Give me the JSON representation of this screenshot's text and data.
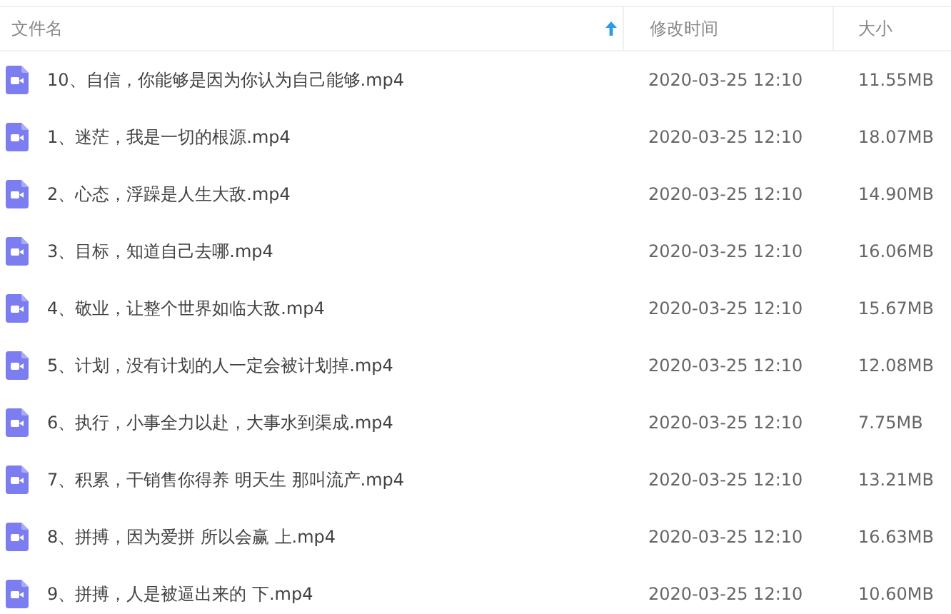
{
  "columns": [
    {
      "label": "文件名",
      "sorted": true
    },
    {
      "label": "修改时间",
      "sorted": false
    },
    {
      "label": "大小",
      "sorted": false
    }
  ],
  "rows": [
    {
      "name": "10、自信，你能够是因为你认为自己能够.mp4",
      "modified": "2020-03-25 12:10",
      "size": "11.55MB"
    },
    {
      "name": "1、迷茫，我是一切的根源.mp4",
      "modified": "2020-03-25 12:10",
      "size": "18.07MB"
    },
    {
      "name": "2、心态，浮躁是人生大敌.mp4",
      "modified": "2020-03-25 12:10",
      "size": "14.90MB"
    },
    {
      "name": "3、目标，知道自己去哪.mp4",
      "modified": "2020-03-25 12:10",
      "size": "16.06MB"
    },
    {
      "name": "4、敬业，让整个世界如临大敌.mp4",
      "modified": "2020-03-25 12:10",
      "size": "15.67MB"
    },
    {
      "name": "5、计划，没有计划的人一定会被计划掉.mp4",
      "modified": "2020-03-25 12:10",
      "size": "12.08MB"
    },
    {
      "name": "6、执行，小事全力以赴，大事水到渠成.mp4",
      "modified": "2020-03-25 12:10",
      "size": "7.75MB"
    },
    {
      "name": "7、积累，干销售你得养 明天生 那叫流产.mp4",
      "modified": "2020-03-25 12:10",
      "size": "13.21MB"
    },
    {
      "name": "8、拼搏，因为爱拼 所以会赢 上.mp4",
      "modified": "2020-03-25 12:10",
      "size": "16.63MB"
    },
    {
      "name": "9、拼搏，人是被逼出来的 下.mp4",
      "modified": "2020-03-25 12:10",
      "size": "10.60MB"
    }
  ]
}
